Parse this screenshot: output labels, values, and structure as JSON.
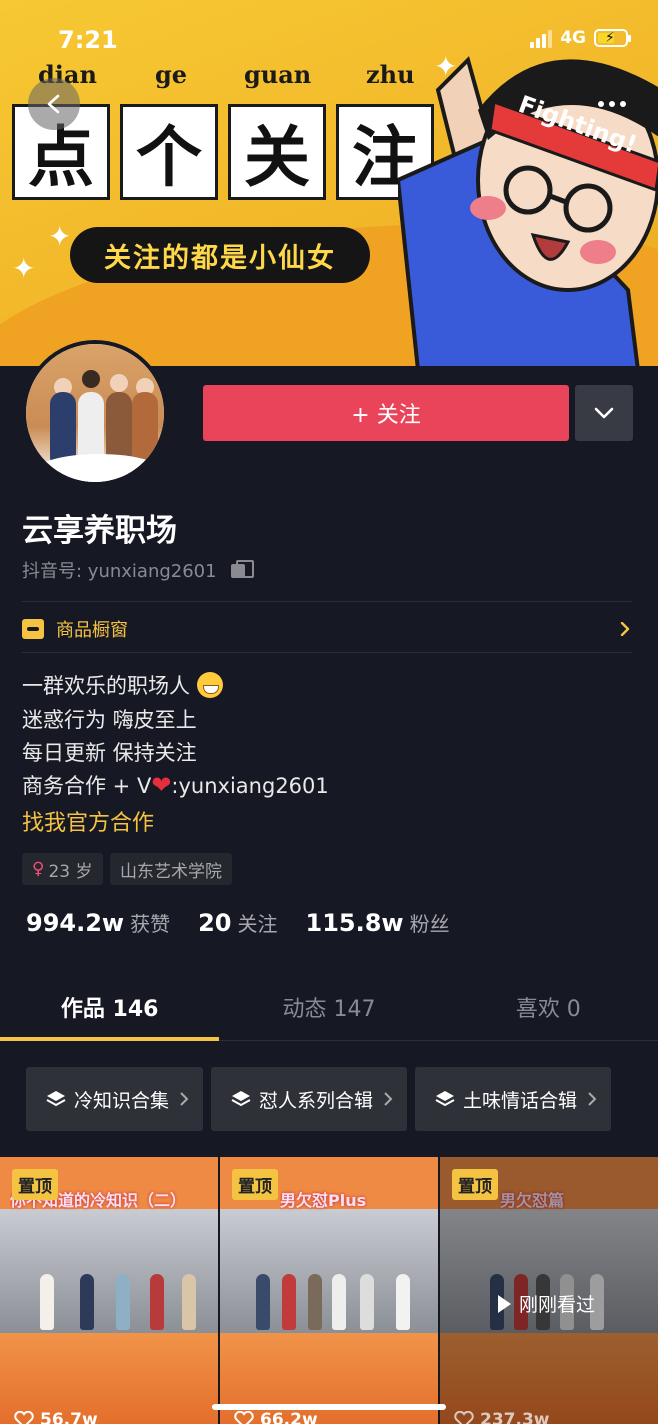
{
  "status_bar": {
    "time": "7:21",
    "network": "4G"
  },
  "banner": {
    "pinyin": [
      "dian",
      "ge",
      "guan",
      "zhu"
    ],
    "chars": [
      "点",
      "个",
      "关",
      "注"
    ],
    "slogan": "关注的都是小仙女",
    "mascot_text": "Fighting!"
  },
  "profile": {
    "follow_label": "+ 关注",
    "nickname": "云享养职场",
    "douyin_id": "抖音号: yunxiang2601",
    "shop_label": "商品橱窗",
    "bio": [
      "一群欢乐的职场人",
      "迷惑行为 嗨皮至上",
      "每日更新 保持关注",
      "商务合作 + V",
      ":yunxiang2601"
    ],
    "coop_link": "找我官方合作",
    "tags": {
      "age": "23 岁",
      "school": "山东艺术学院"
    },
    "stats": [
      {
        "num": "994.2w",
        "label": "获赞"
      },
      {
        "num": "20",
        "label": "关注"
      },
      {
        "num": "115.8w",
        "label": "粉丝"
      }
    ]
  },
  "tabs": [
    {
      "label": "作品 146",
      "active": true
    },
    {
      "label": "动态 147",
      "active": false
    },
    {
      "label": "喜欢 0",
      "active": false
    }
  ],
  "collections": [
    "冷知识合集",
    "怼人系列合辑",
    "土味情话合辑"
  ],
  "videos": [
    {
      "pin": "置顶",
      "title": "你不知道的冷知识（二）",
      "likes": "56.7w"
    },
    {
      "pin": "置顶",
      "title": "男欠怼Plus",
      "likes": "66.2w"
    },
    {
      "pin": "置顶",
      "title": "男欠怼篇",
      "likes": "237.3w",
      "badge": "刚刚看过"
    }
  ],
  "colors": {
    "accent": "#ea445a",
    "gold": "#f5c342",
    "background": "#161823"
  }
}
